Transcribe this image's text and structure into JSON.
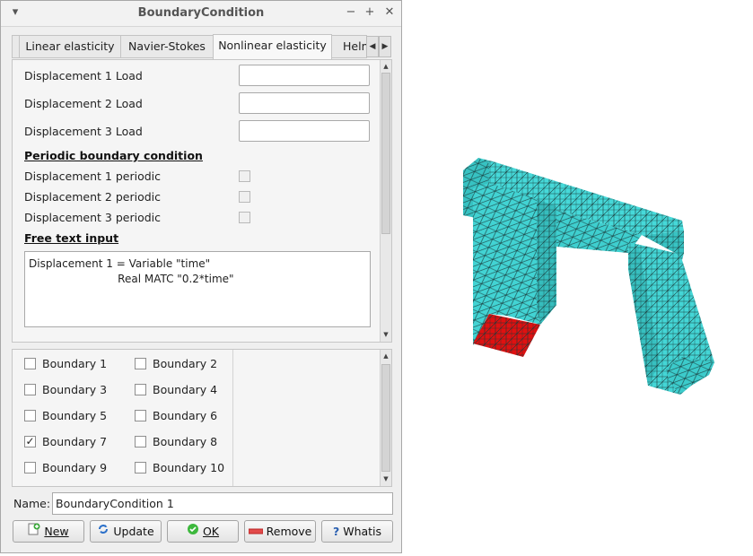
{
  "window": {
    "title": "BoundaryCondition"
  },
  "tabs": [
    {
      "label": "Linear elasticity",
      "active": false
    },
    {
      "label": "Navier-Stokes",
      "active": false
    },
    {
      "label": "Nonlinear elasticity",
      "active": true
    },
    {
      "label": "Helm",
      "active": false
    }
  ],
  "panel": {
    "loads": [
      {
        "label": "Displacement 1 Load",
        "value": ""
      },
      {
        "label": "Displacement 2 Load",
        "value": ""
      },
      {
        "label": "Displacement 3 Load",
        "value": ""
      }
    ],
    "periodic_heading": "Periodic boundary condition",
    "periodic": [
      {
        "label": "Displacement 1 periodic",
        "checked": false
      },
      {
        "label": "Displacement 2 periodic",
        "checked": false
      },
      {
        "label": "Displacement 3 periodic",
        "checked": false
      }
    ],
    "free_text_heading": "Free text input",
    "free_text": "Displacement 1 = Variable \"time\"\n                          Real MATC \"0.2*time\""
  },
  "boundaries": [
    {
      "label": "Boundary 1",
      "checked": false
    },
    {
      "label": "Boundary 2",
      "checked": false
    },
    {
      "label": "Boundary 3",
      "checked": false
    },
    {
      "label": "Boundary 4",
      "checked": false
    },
    {
      "label": "Boundary 5",
      "checked": false
    },
    {
      "label": "Boundary 6",
      "checked": false
    },
    {
      "label": "Boundary 7",
      "checked": true
    },
    {
      "label": "Boundary 8",
      "checked": false
    },
    {
      "label": "Boundary 9",
      "checked": false
    },
    {
      "label": "Boundary 10",
      "checked": false
    }
  ],
  "name": {
    "label": "Name:",
    "value": "BoundaryCondition 1"
  },
  "buttons": {
    "new": "New",
    "update": "Update",
    "ok": "OK",
    "remove": "Remove",
    "whatis": "Whatis"
  },
  "colors": {
    "mesh": "#3fd6d6",
    "selected_boundary": "#e01010",
    "mesh_lines": "#1a3a3a"
  }
}
